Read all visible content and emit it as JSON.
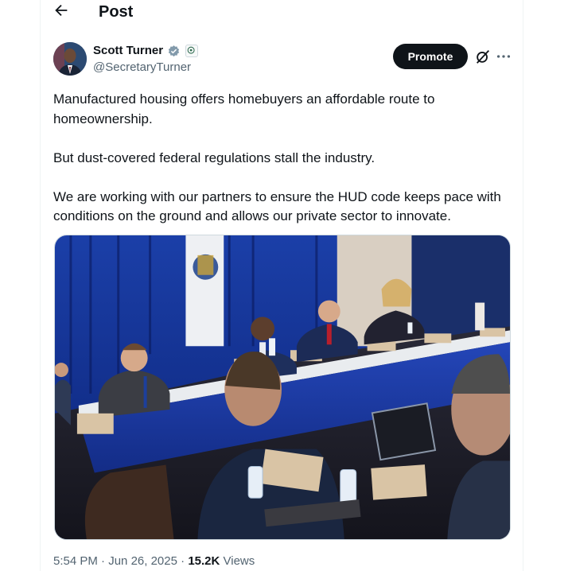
{
  "header": {
    "title": "Post",
    "back_icon": "arrow-left-icon"
  },
  "author": {
    "name": "Scott Turner",
    "handle": "@SecretaryTurner",
    "verified_badge": "verified-badge-icon",
    "affiliation_badge": "government-affiliation-icon",
    "verified_color": "#829aab"
  },
  "actions": {
    "promote_label": "Promote",
    "grok_icon": "grok-icon",
    "more_icon": "more-icon"
  },
  "post": {
    "paragraphs": [
      "Manufactured housing offers homebuyers an affordable route to homeownership.",
      "But dust-covered federal regulations stall the industry.",
      "We are working with our partners to ensure the HUD code keeps pace with conditions on the ground and allows our private sector to innovate."
    ],
    "media_alt": "Meeting around a table with blue skirting and name placards"
  },
  "meta": {
    "time": "5:54 PM",
    "separator": "·",
    "date": "Jun 26, 2025",
    "views_count": "15.2K",
    "views_label": "Views"
  },
  "colors": {
    "text": "#0f1419",
    "secondary": "#536471",
    "border": "#eff3f4",
    "button": "#0f1419"
  }
}
